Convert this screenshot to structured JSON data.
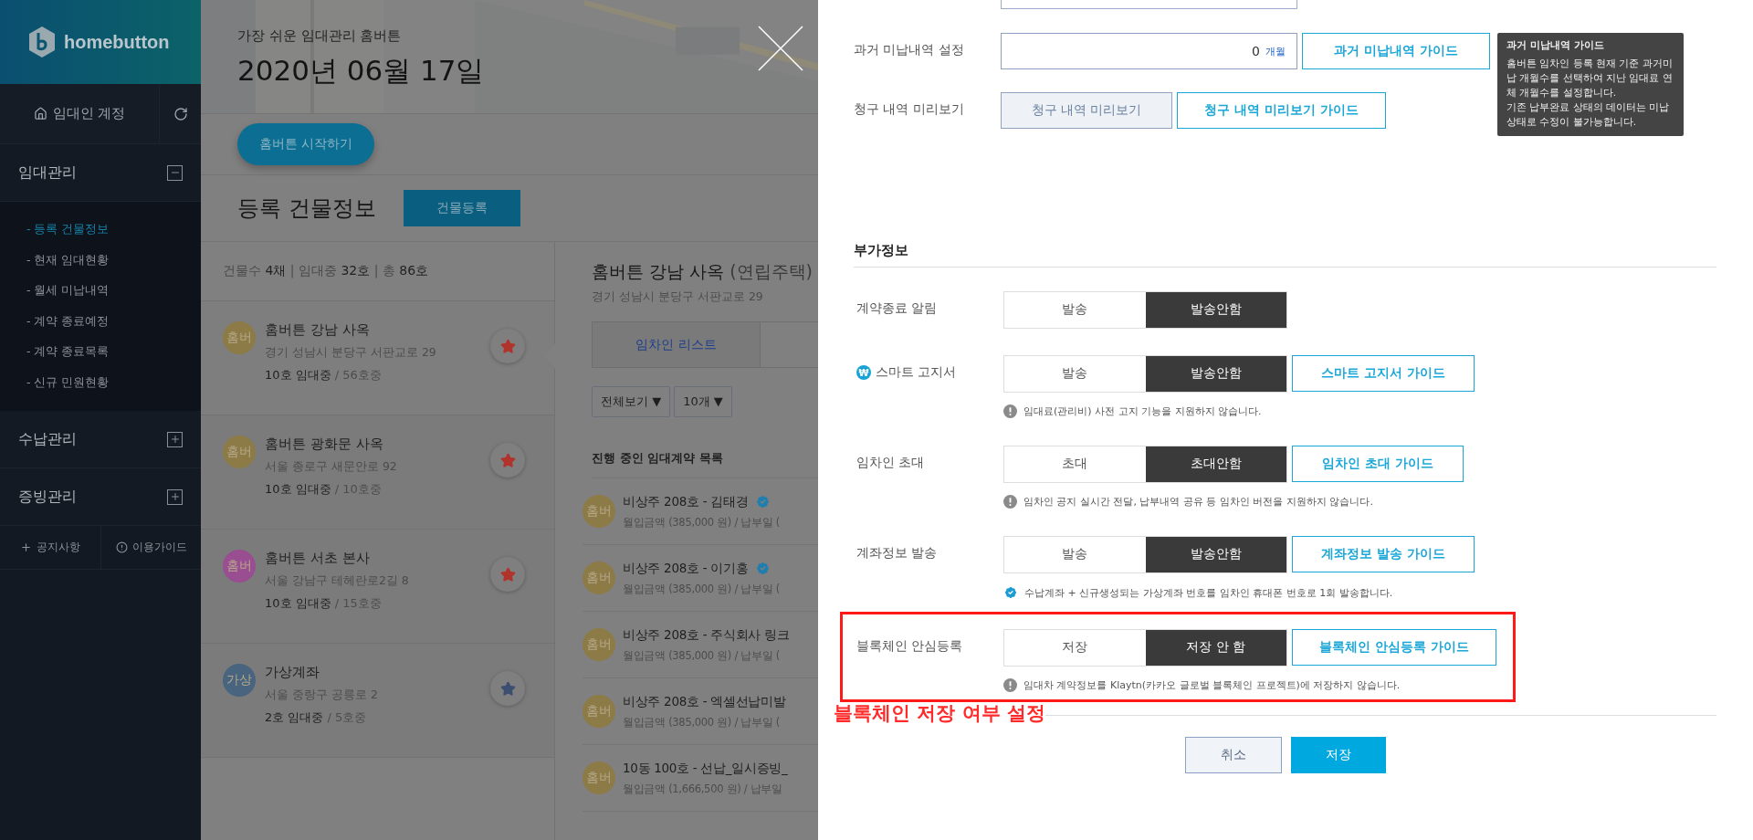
{
  "sidebar": {
    "logo": "homebutton",
    "account": "임대인 계정",
    "menus": [
      {
        "label": "임대관리",
        "expanded": true,
        "children": [
          {
            "label": "- 등록 건물정보",
            "selected": true
          },
          {
            "label": "- 현재 임대현황",
            "selected": false
          },
          {
            "label": "- 월세 미납내역",
            "selected": false
          },
          {
            "label": "- 계약 종료예정",
            "selected": false
          },
          {
            "label": "- 계약 종료목록",
            "selected": false
          },
          {
            "label": "- 신규 민원현황",
            "selected": false
          }
        ]
      },
      {
        "label": "수납관리",
        "expanded": false
      },
      {
        "label": "증빙관리",
        "expanded": false
      }
    ],
    "footer": [
      {
        "kind": "plus",
        "label": "공지사항"
      },
      {
        "kind": "info",
        "label": "이용가이드"
      }
    ]
  },
  "header": {
    "subtitle": "가장 쉬운 임대관리 홈버튼",
    "date": "2020년 06월 17일"
  },
  "start_button": "홈버튼 시작하기",
  "section": {
    "title": "등록 건물정보",
    "button": "건물등록"
  },
  "buildings": {
    "summary": "건물수 **4채** | 임대중 **32호** | 총 **86호**",
    "items": [
      {
        "avatar": "홈버",
        "color": "#8c7b46",
        "name": "홈버튼 강남 사옥",
        "address": "경기 성남시 분당구 서판교로 29",
        "occupancy": "10호 임대중",
        "total": "/ 56호중",
        "favorite": true,
        "selected": true
      },
      {
        "avatar": "홈버",
        "color": "#8c7b46",
        "name": "홈버튼 광화문 사옥",
        "address": "서울 종로구 새문안로 92",
        "occupancy": "10호 임대중",
        "total": "/ 10호중",
        "favorite": true,
        "selected": false
      },
      {
        "avatar": "홈버",
        "color": "#9a4e92",
        "name": "홈버튼 서초 본사",
        "address": "서울 강남구 테헤란로2길 8",
        "occupancy": "10호 임대중",
        "total": "/ 15호중",
        "favorite": true,
        "selected": false
      },
      {
        "avatar": "가상",
        "color": "#48647e",
        "name": "가상계좌",
        "address": "서울 중랑구 공릉로 2",
        "occupancy": "2호 임대중",
        "total": "/ 5호중",
        "favorite": false,
        "selected": false
      }
    ]
  },
  "detail": {
    "title": "홈버튼 강남 사옥",
    "type": "(연립주택)",
    "address": "경기 성남시 분당구 서판교로 29",
    "tabs": [
      {
        "label": "임차인 리스트",
        "selected": true
      }
    ],
    "filters": [
      "전체보기 ▼",
      "10개 ▼"
    ],
    "list_title": "진행 중인 임대계약 목록",
    "contracts": [
      {
        "avatar": "홈버",
        "title": "비상주 208호 - 김태경",
        "verified": true,
        "detail": "월입금액 (385,000 원) / 납부일 ("
      },
      {
        "avatar": "홈버",
        "title": "비상주 208호 - 이기홍",
        "verified": true,
        "detail": "월입금액 (385,000 원) / 납부일 ("
      },
      {
        "avatar": "홈버",
        "title": "비상주 208호 - 주식회사 링크",
        "verified": false,
        "detail": "월입금액 (385,000 원) / 납부일 ("
      },
      {
        "avatar": "홈버",
        "title": "비상주 208호 - 엑셀선납미발",
        "verified": false,
        "detail": "월입금액 (385,000 원) / 납부일 ("
      },
      {
        "avatar": "홈버",
        "title": "10동 100호 - 선납_일시증빙_",
        "verified": false,
        "detail": "월입금액 (1,666,500 원) / 납부일"
      }
    ]
  },
  "drawer": {
    "rows": [
      {
        "kind": "field",
        "label": "과거 미납내역 설정",
        "value": "0",
        "unit": "개월",
        "guide": "과거 미납내역 가이드"
      },
      {
        "kind": "button",
        "label": "청구 내역 미리보기",
        "button": "청구 내역 미리보기",
        "guide": "청구 내역 미리보기 가이드"
      }
    ],
    "tooltip": {
      "title": "과거 미납내역 가이드",
      "lines": [
        "홈버튼 임차인 등록 현재 기준 과거미납 개월수를 선택하여 지난 임대료 연체 개월수를 설정합니다.",
        "기존 납부완료 상태의 데이터는 미납 상태로 수정이 불가능합니다."
      ]
    },
    "section_title": "부가정보",
    "toggles": [
      {
        "label": "계약종료 알림",
        "options": [
          {
            "label": "발송",
            "selected": false
          },
          {
            "label": "발송안함",
            "selected": true
          }
        ],
        "highlighted": false
      },
      {
        "label": "스마트 고지서",
        "label_icon": "₩",
        "options": [
          {
            "label": "발송",
            "selected": false
          },
          {
            "label": "발송안함",
            "selected": true
          }
        ],
        "guide": "스마트 고지서 가이드",
        "note": {
          "kind": "warning",
          "text": "임대료(관리비) 사전 고지 기능을 지원하지 않습니다."
        },
        "highlighted": false
      },
      {
        "label": "임차인 초대",
        "options": [
          {
            "label": "초대",
            "selected": false
          },
          {
            "label": "초대안함",
            "selected": true
          }
        ],
        "guide": "임차인 초대 가이드",
        "note": {
          "kind": "warning",
          "text": "임차인 공지 실시간 전달, 납부내역 공유 등 임차인 버전을 지원하지 않습니다."
        },
        "highlighted": false
      },
      {
        "label": "계좌정보 발송",
        "options": [
          {
            "label": "발송",
            "selected": false
          },
          {
            "label": "발송안함",
            "selected": true
          }
        ],
        "guide": "계좌정보 발송 가이드",
        "note": {
          "kind": "check",
          "text": "수납계좌 + 신규생성되는 가상계좌 번호를 임차인 휴대폰 번호로 1회 발송합니다."
        },
        "highlighted": false
      },
      {
        "label": "블록체인 안심등록",
        "options": [
          {
            "label": "저장",
            "selected": false
          },
          {
            "label": "저장 안 함",
            "selected": true
          }
        ],
        "guide": "블록체인 안심등록 가이드",
        "note": {
          "kind": "warning",
          "text": "임대차 계약정보를 Klaytn(카카오 글로벌 블록체인 프로젝트)에 저장하지 않습니다."
        },
        "highlighted": true
      }
    ],
    "annotation": "블록체인 저장 여부 설정",
    "buttons": [
      {
        "label": "취소",
        "kind": "secondary"
      },
      {
        "label": "저장",
        "kind": "primary"
      }
    ]
  }
}
